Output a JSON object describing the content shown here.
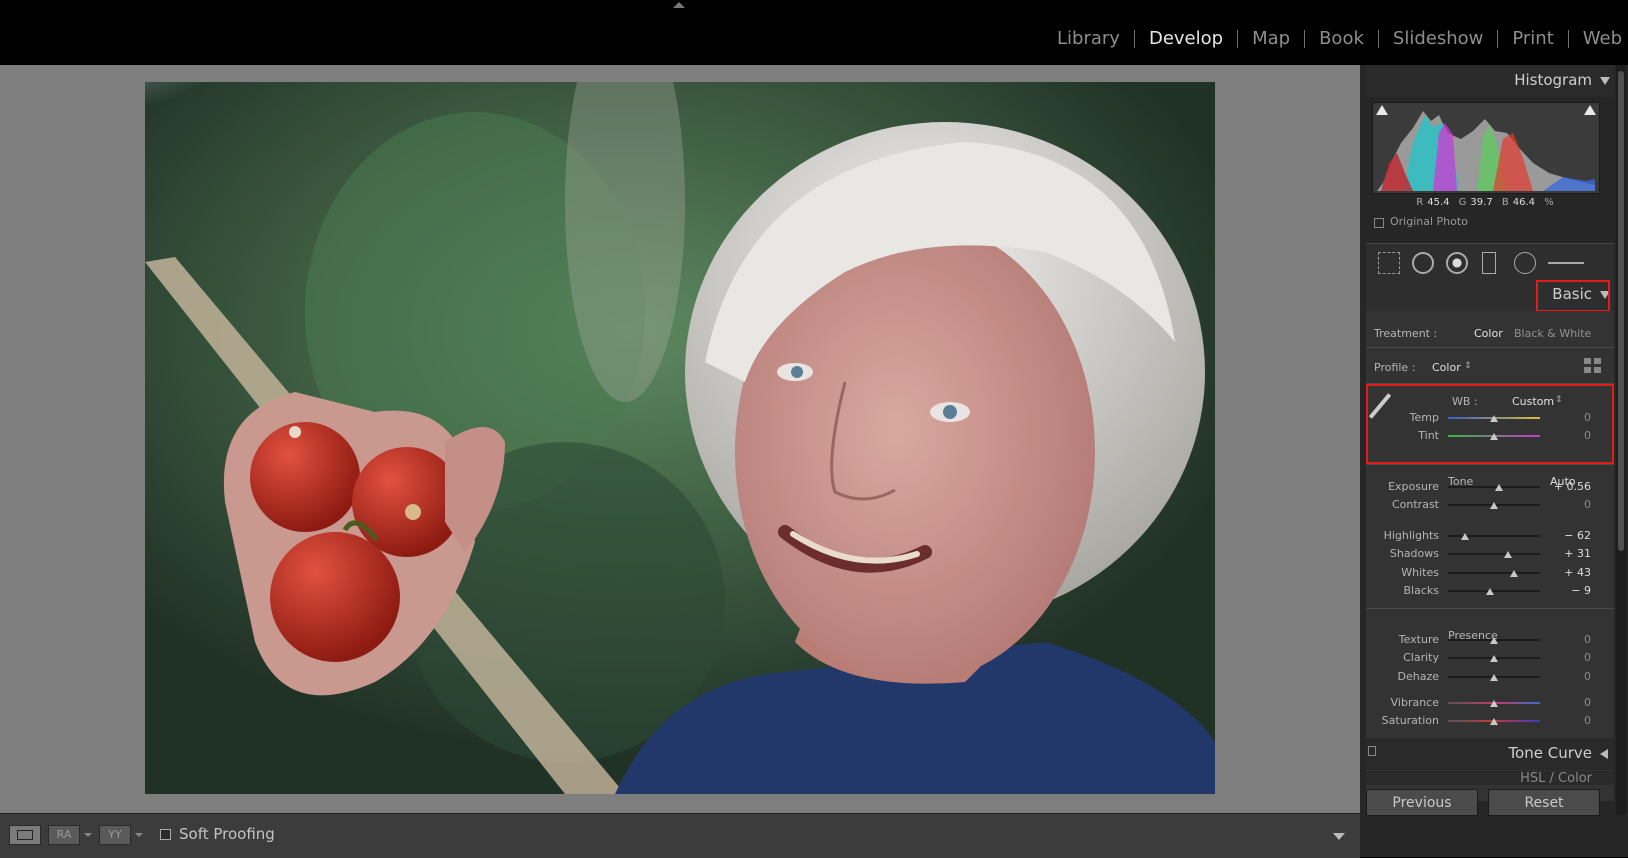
{
  "modules": [
    "Library",
    "Develop",
    "Map",
    "Book",
    "Slideshow",
    "Print",
    "Web"
  ],
  "active_module": "Develop",
  "toolbar": {
    "ra_label": "RA",
    "yy_label": "YY",
    "soft_proofing_label": "Soft Proofing"
  },
  "histogram": {
    "title": "Histogram",
    "r_label": "R",
    "r_value": "45.4",
    "g_label": "G",
    "g_value": "39.7",
    "b_label": "B",
    "b_value": "46.4",
    "unit": "%",
    "original_photo_label": "Original Photo"
  },
  "basic": {
    "title": "Basic",
    "treatment_label": "Treatment :",
    "treatment_color": "Color",
    "treatment_bw": "Black & White",
    "profile_label": "Profile :",
    "profile_value": "Color",
    "wb_label": "WB :",
    "wb_value": "Custom",
    "tone_label": "Tone",
    "auto_label": "Auto",
    "presence_label": "Presence",
    "sliders": [
      {
        "label": "Temp",
        "value": "0",
        "pos": 0.5
      },
      {
        "label": "Tint",
        "value": "0",
        "pos": 0.5
      },
      {
        "label": "Exposure",
        "value": "+ 0.56",
        "pos": 0.556
      },
      {
        "label": "Contrast",
        "value": "0",
        "pos": 0.5
      },
      {
        "label": "Highlights",
        "value": "− 62",
        "pos": 0.19
      },
      {
        "label": "Shadows",
        "value": "+ 31",
        "pos": 0.655
      },
      {
        "label": "Whites",
        "value": "+ 43",
        "pos": 0.715
      },
      {
        "label": "Blacks",
        "value": "− 9",
        "pos": 0.455
      },
      {
        "label": "Texture",
        "value": "0",
        "pos": 0.5
      },
      {
        "label": "Clarity",
        "value": "0",
        "pos": 0.5
      },
      {
        "label": "Dehaze",
        "value": "0",
        "pos": 0.5
      },
      {
        "label": "Vibrance",
        "value": "0",
        "pos": 0.5
      },
      {
        "label": "Saturation",
        "value": "0",
        "pos": 0.5
      }
    ]
  },
  "tone_curve": {
    "title": "Tone Curve"
  },
  "hsl": {
    "title": "HSL / Color"
  },
  "buttons": {
    "previous": "Previous",
    "reset": "Reset"
  },
  "colors": {
    "highlight_box": "#e31b1b"
  }
}
